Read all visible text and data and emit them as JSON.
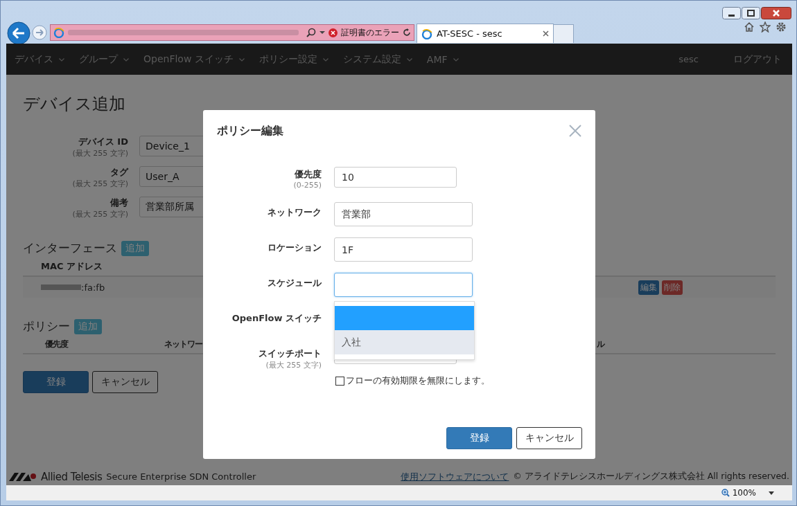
{
  "browser": {
    "address_bar": {
      "status": "証明書のエラー"
    },
    "tabs": [
      {
        "title": "AT-SESC - sesc",
        "selected": true
      }
    ],
    "zoom": "100%"
  },
  "navbar": {
    "menus": [
      {
        "label": "デバイス",
        "has_caret": true
      },
      {
        "label": "グループ",
        "has_caret": true
      },
      {
        "label": "OpenFlow スイッチ",
        "has_caret": true
      },
      {
        "label": "ポリシー設定",
        "has_caret": true
      },
      {
        "label": "システム設定",
        "has_caret": true
      },
      {
        "label": "AMF",
        "has_caret": true
      }
    ],
    "user": "sesc",
    "logout": "ログアウト"
  },
  "page": {
    "title": "デバイス追加",
    "fields": [
      {
        "label": "デバイス ID",
        "hint": "(最大 255 文字)",
        "value": "Device_1"
      },
      {
        "label": "タグ",
        "hint": "(最大 255 文字)",
        "value": "User_A"
      },
      {
        "label": "備考",
        "hint": "(最大 255 文字)",
        "value": "営業部所属"
      }
    ],
    "interfaces": {
      "heading": "インターフェース",
      "add_button": "追加",
      "columns": [
        "MAC アドレス"
      ],
      "rows": [
        {
          "mac": ":fa:fb",
          "edit": "編集",
          "delete": "削除"
        }
      ]
    },
    "policies": {
      "heading": "ポリシー",
      "add_button": "追加",
      "columns": [
        "優先度",
        "ネットワー",
        "ル"
      ]
    },
    "buttons": {
      "submit": "登録",
      "cancel": "キャンセル"
    }
  },
  "modal": {
    "title": "ポリシー編集",
    "fields": [
      {
        "kind": "short",
        "label": "優先度",
        "hint": "(0-255)",
        "value": "10",
        "focused": false
      },
      {
        "kind": "wide",
        "label": "ネットワーク",
        "value": "営業部",
        "focused": false
      },
      {
        "kind": "wide",
        "label": "ロケーション",
        "value": "1F",
        "focused": false
      },
      {
        "kind": "wide",
        "label": "スケジュール",
        "focused": true,
        "dropdown": [
          {
            "highlighted": true
          },
          {
            "label": "入社",
            "highlighted": false
          }
        ]
      },
      {
        "kind": "hidden",
        "label": "OpenFlow スイッチ"
      },
      {
        "kind": "short",
        "label": "スイッチポート",
        "hint": "(最大 255 文字)",
        "focused": false
      }
    ],
    "checkbox": {
      "label": "フローの有効期限を無限にします。",
      "checked": false
    },
    "buttons": {
      "submit": "登録",
      "cancel": "キャンセル"
    }
  },
  "footer": {
    "brand": "Allied Telesis",
    "product": "Secure Enterprise SDN Controller",
    "link": "使用ソフトウェアについて",
    "copyright": "© アライドテレシスホールディングス株式会社 All rights reserved."
  }
}
